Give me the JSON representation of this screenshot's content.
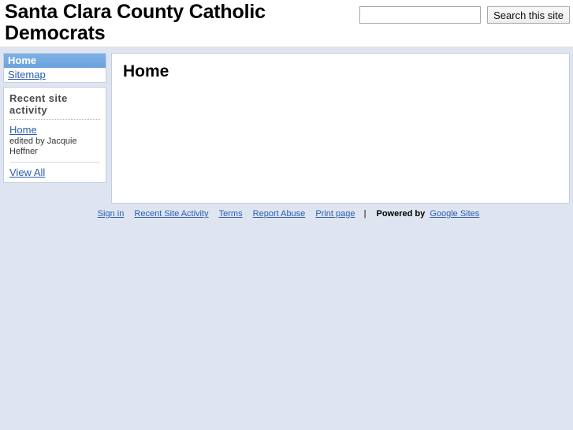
{
  "header": {
    "site_title": "Santa Clara County Catholic Democrats",
    "search": {
      "value": "",
      "placeholder": "",
      "button_label": "Search this site"
    }
  },
  "sidebar": {
    "nav": {
      "items": [
        {
          "label": "Home",
          "selected": true
        },
        {
          "label": "Sitemap",
          "selected": false
        }
      ]
    },
    "activity": {
      "title": "Recent site activity",
      "entries": [
        {
          "page_label": "Home",
          "meta": "edited by Jacquie Heffner"
        }
      ],
      "view_all_label": "View All"
    }
  },
  "main": {
    "page_title": "Home",
    "body_text": ""
  },
  "footer": {
    "links": [
      "Sign in",
      "Recent Site Activity",
      "Terms",
      "Report Abuse",
      "Print page"
    ],
    "separator": "|",
    "powered_by_label": "Powered by",
    "powered_by_link": "Google Sites"
  },
  "colors": {
    "page_background": "#dfe5f0",
    "panel_border": "#c3cedd",
    "nav_selected": "#6ea7e0",
    "link": "#2a5db0"
  }
}
